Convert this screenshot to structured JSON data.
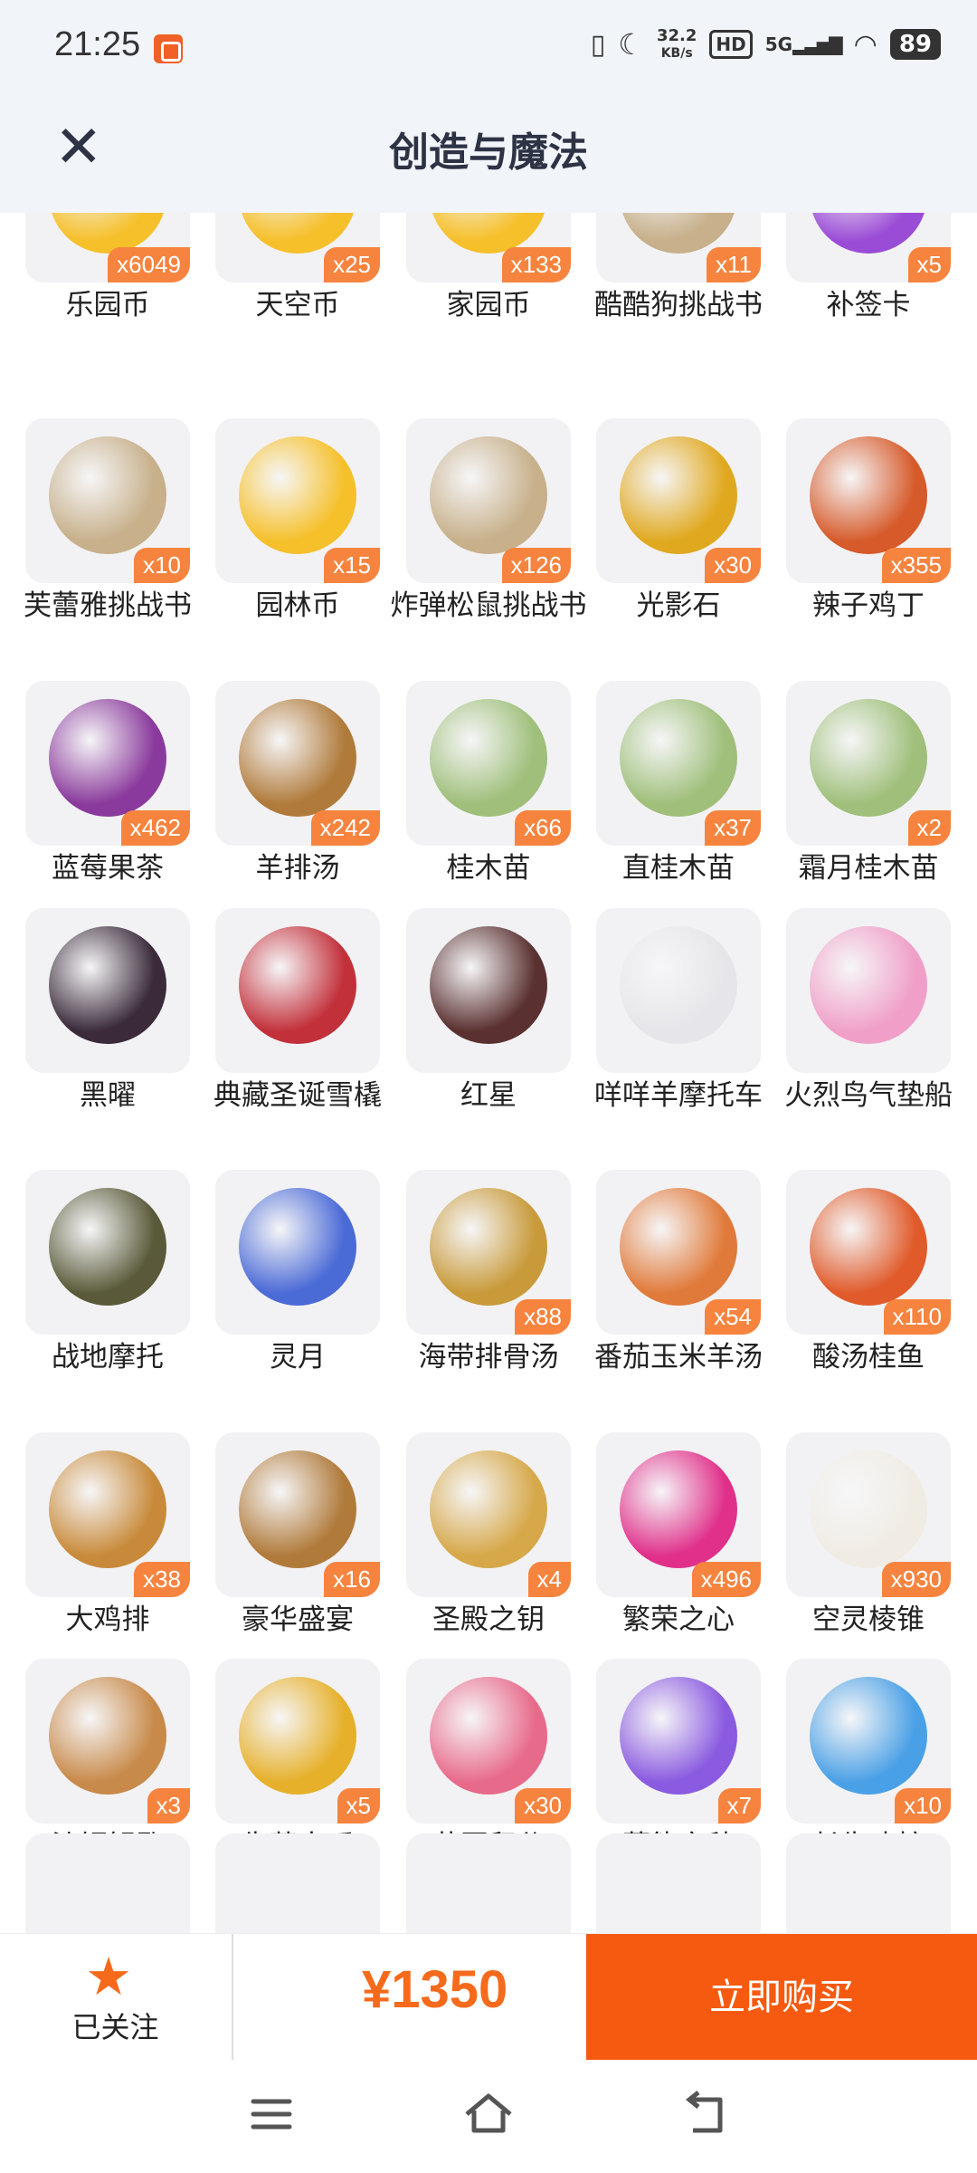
{
  "status": {
    "time": "21:25",
    "network_speed_value": "32.2",
    "network_speed_unit": "KB/s",
    "hd": "HD",
    "signal": "5G",
    "battery": "89"
  },
  "header": {
    "title": "创造与魔法",
    "close_icon": "close-icon"
  },
  "items": [
    {
      "name": "乐园币",
      "count": "x6049",
      "color": "#f6c02a"
    },
    {
      "name": "天空币",
      "count": "x25",
      "color": "#f6c02a"
    },
    {
      "name": "家园币",
      "count": "x133",
      "color": "#f6c02a"
    },
    {
      "name": "酷酷狗挑战书",
      "count": "x11",
      "color": "#c7b08a"
    },
    {
      "name": "补签卡",
      "count": "x5",
      "color": "#9b4cd6"
    },
    {
      "name": "芙蕾雅挑战书",
      "count": "x10",
      "color": "#c7b08a"
    },
    {
      "name": "园林币",
      "count": "x15",
      "color": "#f6c02a"
    },
    {
      "name": "炸弹松鼠挑战书",
      "count": "x126",
      "color": "#c7b08a"
    },
    {
      "name": "光影石",
      "count": "x30",
      "color": "#e0a81e"
    },
    {
      "name": "辣子鸡丁",
      "count": "x355",
      "color": "#d65a2a"
    },
    {
      "name": "蓝莓果茶",
      "count": "x462",
      "color": "#8a3a9c"
    },
    {
      "name": "羊排汤",
      "count": "x242",
      "color": "#b07a3a"
    },
    {
      "name": "桂木苗",
      "count": "x66",
      "color": "#9fbf7a"
    },
    {
      "name": "直桂木苗",
      "count": "x37",
      "color": "#9fbf7a"
    },
    {
      "name": "霜月桂木苗",
      "count": "x2",
      "color": "#9fbf7a"
    },
    {
      "name": "黑曜",
      "count": "",
      "color": "#3a2a3a"
    },
    {
      "name": "典藏圣诞雪橇",
      "count": "",
      "color": "#c2303a"
    },
    {
      "name": "红星",
      "count": "",
      "color": "#5a3030"
    },
    {
      "name": "咩咩羊摩托车",
      "count": "",
      "color": "#e6e6ea"
    },
    {
      "name": "火烈鸟气垫船",
      "count": "",
      "color": "#f0a0c8"
    },
    {
      "name": "战地摩托",
      "count": "",
      "color": "#5a5a3a"
    },
    {
      "name": "灵月",
      "count": "",
      "color": "#4a6ad6"
    },
    {
      "name": "海带排骨汤",
      "count": "x88",
      "color": "#c89a3a"
    },
    {
      "name": "番茄玉米羊汤",
      "count": "x54",
      "color": "#e07a3a"
    },
    {
      "name": "酸汤桂鱼",
      "count": "x110",
      "color": "#e05a2a"
    },
    {
      "name": "大鸡排",
      "count": "x38",
      "color": "#c88a3a"
    },
    {
      "name": "豪华盛宴",
      "count": "x16",
      "color": "#b07a3a"
    },
    {
      "name": "圣殿之钥",
      "count": "x4",
      "color": "#d6a84a"
    },
    {
      "name": "繁荣之心",
      "count": "x496",
      "color": "#e0308a"
    },
    {
      "name": "空灵棱锥",
      "count": "x930",
      "color": "#f0ece4"
    },
    {
      "name": "沙铜钥匙",
      "count": "x3",
      "color": "#c88a4a"
    },
    {
      "name": "失落古币",
      "count": "x5",
      "color": "#e6b02a"
    },
    {
      "name": "花园积分",
      "count": "x30",
      "color": "#e86a8a"
    },
    {
      "name": "蕴能之种",
      "count": "x7",
      "color": "#8a5ae0"
    },
    {
      "name": "长生冰核",
      "count": "x10",
      "color": "#4aa0e6"
    }
  ],
  "bottom": {
    "follow_label": "已关注",
    "price": "¥1350",
    "buy_label": "立即购买",
    "accent": "#f65a10"
  }
}
